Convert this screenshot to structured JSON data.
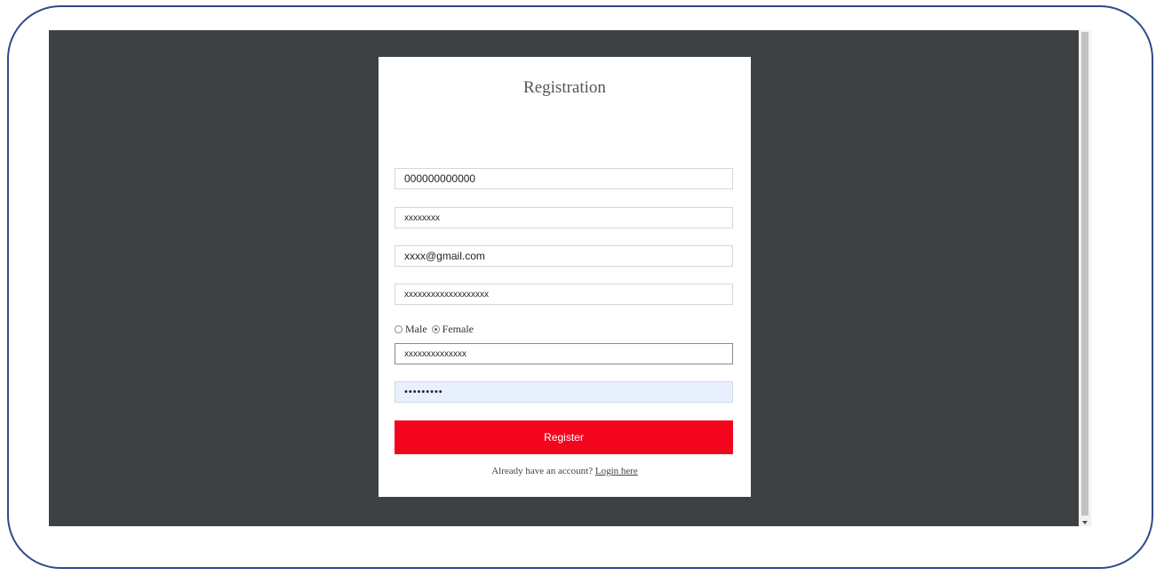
{
  "form": {
    "title": "Registration",
    "phone_value": "000000000000",
    "name_value": "xxxxxxxx",
    "email_value": "xxxx@gmail.com",
    "address_value": "xxxxxxxxxxxxxxxxxxx",
    "gender_options": [
      "Male",
      "Female"
    ],
    "gender_selected": "Female",
    "username_value": "xxxxxxxxxxxxxx",
    "password_value": "•••••••••",
    "register_label": "Register",
    "login_prompt": "Already have an account?",
    "login_link": "Login here"
  },
  "colors": {
    "page_background": "#3e4144",
    "button": "#f3051e",
    "frame_border": "#2f4a8a"
  }
}
